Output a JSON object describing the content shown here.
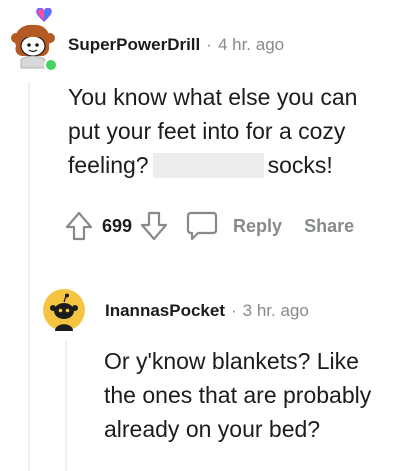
{
  "comment": {
    "username": "SuperPowerDrill",
    "separator": "·",
    "timestamp": "4 hr. ago",
    "body": {
      "line1": "You know what else you can",
      "line2": "put your feet into for a cozy",
      "line3_start": "feeling?",
      "line3_end": "socks!"
    },
    "votes": "699",
    "reply_label": "Reply",
    "share_label": "Share",
    "online_color": "#46d160",
    "accent_colors": [
      "#ff4f9a",
      "#8a5cf6",
      "#3b82f6"
    ]
  },
  "reply": {
    "username": "InannasPocket",
    "separator": "·",
    "timestamp": "3 hr. ago",
    "body": {
      "line1": "Or y'know blankets? Like",
      "line2": "the ones that are probably",
      "line3": "already on your bed?"
    },
    "avatar_color": "#f5c542"
  },
  "icons": {
    "upvote": "upvote-arrow-icon",
    "downvote": "downvote-arrow-icon",
    "comment": "speech-bubble-icon"
  }
}
